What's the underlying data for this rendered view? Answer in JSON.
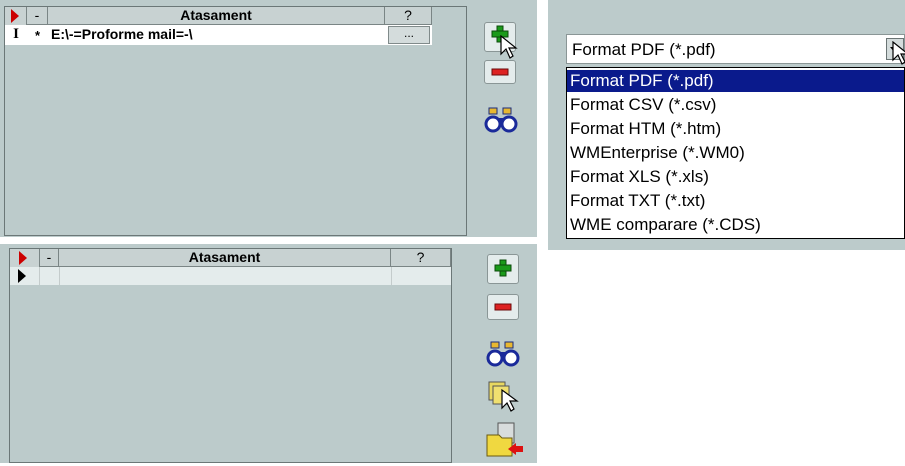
{
  "top_grid": {
    "headers": {
      "marker": "-",
      "attachment": "Atasament",
      "help": "?"
    },
    "row": {
      "marker": "*",
      "attachment": "E:\\-=Proforme mail=-\\",
      "browse_label": "..."
    }
  },
  "bottom_grid": {
    "headers": {
      "marker": "-",
      "attachment": "Atasament",
      "help": "?"
    }
  },
  "format_select": {
    "selected": "Format PDF (*.pdf)",
    "options": [
      "Format PDF (*.pdf)",
      "Format CSV (*.csv)",
      "Format HTM (*.htm)",
      "WMEnterprise (*.WM0)",
      "Format XLS (*.xls)",
      "Format TXT (*.txt)",
      "WME comparare (*.CDS)"
    ]
  },
  "colors": {
    "panel": "#bccbcb",
    "selection": "#0a1a8c",
    "add_green": "#1a9a1a",
    "remove_red": "#cc1111",
    "row_indicator": "#cc0000"
  }
}
